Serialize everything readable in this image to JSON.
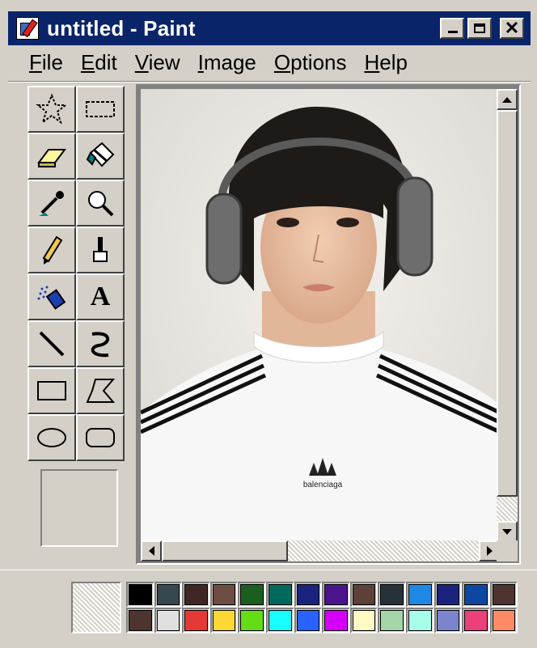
{
  "window": {
    "title": "untitled - Paint",
    "controls": [
      "minimize",
      "maximize",
      "close"
    ]
  },
  "menu": [
    {
      "label": "File",
      "accel": "F",
      "rest": "ile"
    },
    {
      "label": "Edit",
      "accel": "E",
      "rest": "dit"
    },
    {
      "label": "View",
      "accel": "V",
      "rest": "iew"
    },
    {
      "label": "Image",
      "accel": "I",
      "rest": "mage"
    },
    {
      "label": "Options",
      "accel": "O",
      "rest": "ptions"
    },
    {
      "label": "Help",
      "accel": "H",
      "rest": "elp"
    }
  ],
  "tools": [
    {
      "name": "free-form-select",
      "icon": "star-select-icon"
    },
    {
      "name": "select",
      "icon": "rect-select-icon"
    },
    {
      "name": "eraser",
      "icon": "eraser-icon"
    },
    {
      "name": "fill",
      "icon": "fill-bucket-icon"
    },
    {
      "name": "pick-color",
      "icon": "eyedropper-icon"
    },
    {
      "name": "magnifier",
      "icon": "magnifier-icon"
    },
    {
      "name": "pencil",
      "icon": "pencil-icon"
    },
    {
      "name": "brush",
      "icon": "brush-icon"
    },
    {
      "name": "airbrush",
      "icon": "airbrush-icon"
    },
    {
      "name": "text",
      "icon": "text-icon",
      "glyph": "A"
    },
    {
      "name": "line",
      "icon": "line-icon"
    },
    {
      "name": "curve",
      "icon": "curve-icon"
    },
    {
      "name": "rectangle",
      "icon": "rectangle-icon"
    },
    {
      "name": "polygon",
      "icon": "polygon-icon"
    },
    {
      "name": "ellipse",
      "icon": "ellipse-icon"
    },
    {
      "name": "rounded-rectangle",
      "icon": "rounded-rectangle-icon"
    }
  ],
  "canvas": {
    "image": "portrait-photo",
    "shirt_logo_text": "balenciaga"
  },
  "colors": {
    "titlebar": "#0a246a",
    "face": "#d4d0c8"
  },
  "palette": [
    "#000000",
    "#37474f",
    "#3e2723",
    "#6d4c41",
    "#1b5e20",
    "#00695c",
    "#1a237e",
    "#4a148c",
    "#5d4037",
    "#263238",
    "#1e88e5",
    "#1a237e",
    "#0d47a1",
    "#4e342e",
    "#4e342e",
    "#e0e0e0",
    "#e53935",
    "#fdd835",
    "#64dd17",
    "#18ffff",
    "#2962ff",
    "#d500f9",
    "#fff9c4",
    "#a5d6a7",
    "#a7ffeb",
    "#7986cb",
    "#ec407a",
    "#ff8a65"
  ]
}
